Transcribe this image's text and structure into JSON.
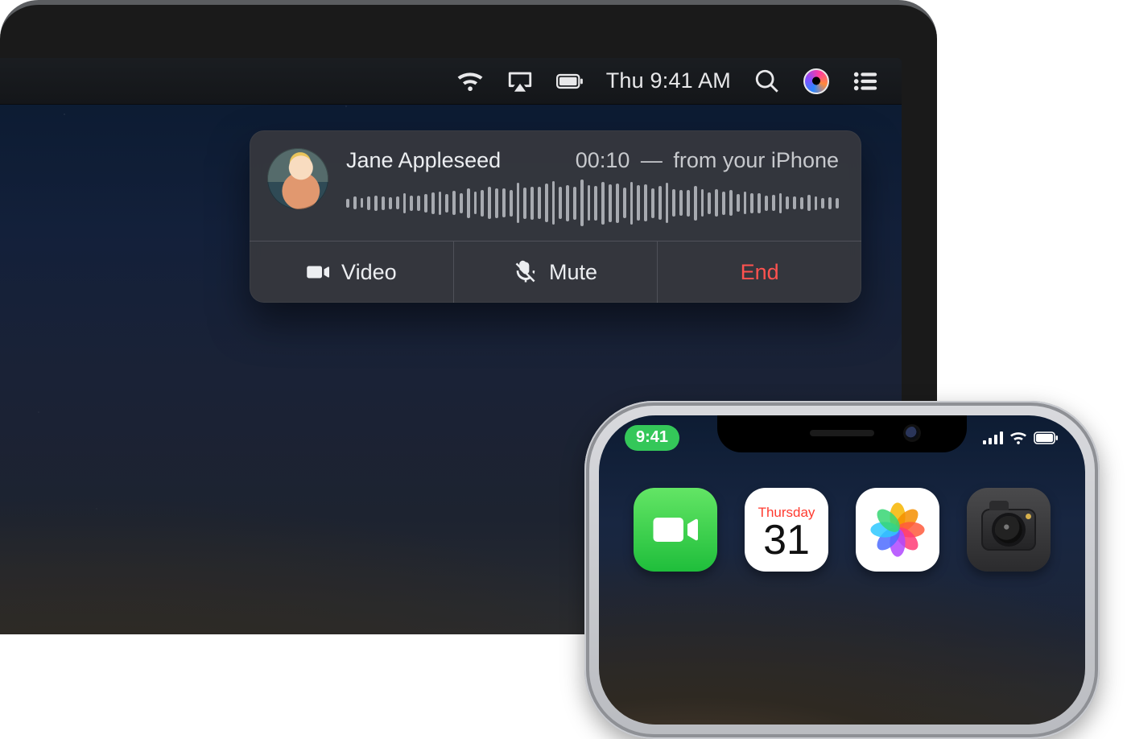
{
  "mac": {
    "menubar": {
      "clock": "Thu 9:41 AM",
      "icons": {
        "wifi": "wifi-icon",
        "airplay": "airplay-icon",
        "battery": "battery-icon",
        "search": "search-icon",
        "siri": "siri-icon",
        "notification_center": "notification-center-icon"
      }
    },
    "call": {
      "caller_name": "Jane Appleseed",
      "duration": "00:10",
      "source": "from your iPhone",
      "separator": "—",
      "buttons": {
        "video": "Video",
        "mute": "Mute",
        "end": "End"
      }
    }
  },
  "iphone": {
    "status": {
      "time": "9:41",
      "call_active": true
    },
    "apps": {
      "facetime": "FaceTime",
      "calendar": {
        "day": "Thursday",
        "date": "31"
      },
      "photos": "Photos",
      "camera": "Camera"
    }
  },
  "colors": {
    "end_call": "#ff524f",
    "ios_green": "#34c759"
  }
}
